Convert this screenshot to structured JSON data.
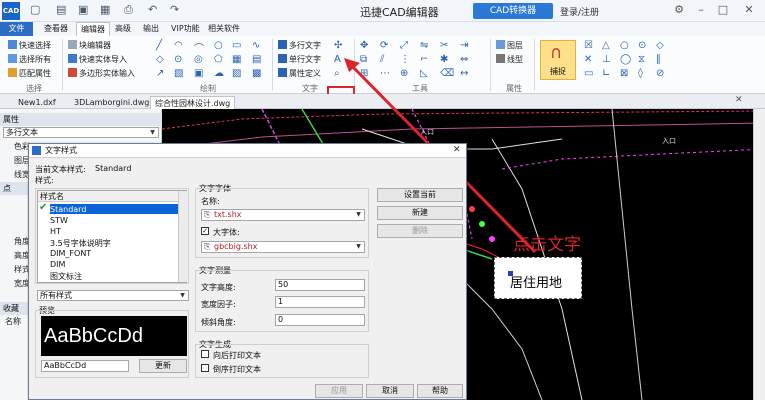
{
  "app": {
    "logo": "CAD",
    "title": "迅捷CAD编辑器",
    "convert_label": "CAD转换器",
    "login": "登录/注册"
  },
  "menu": {
    "tabs": [
      "文件",
      "查看器",
      "编辑器",
      "高级",
      "输出",
      "VIP功能",
      "相关软件"
    ]
  },
  "ribbon": {
    "select_group": [
      "快速选择",
      "选择所有",
      "匹配属性"
    ],
    "edit_group": [
      "块编辑器",
      "快速实体导入",
      "多边形实体输入"
    ],
    "text_group": [
      "多行文字",
      "单行文字",
      "属性定义"
    ],
    "layer_items": [
      "图层",
      "线型"
    ],
    "snap_label": "捕捉",
    "groups": [
      "选择",
      "绘制",
      "文字",
      "工具",
      "属性"
    ]
  },
  "doc_tabs": [
    "New1.dxf",
    "3DLamborgini.dwg",
    "综合性园林设计.dwg"
  ],
  "props": {
    "title": "属性",
    "selector": "多行文本",
    "rows": [
      "色彩",
      "图层",
      "线宽"
    ],
    "section_point": "点",
    "rows2": [
      "角度",
      "高度",
      "样式",
      "宽度"
    ],
    "section_collect": "收藏",
    "section_name": "名称"
  },
  "dialog": {
    "title": "文字样式",
    "current_label": "当前文本样式:",
    "current_value": "Standard",
    "style_label": "样式:",
    "list_header": "样式名",
    "styles": [
      "Standard",
      "STW",
      "HT",
      "3.5号字体说明字",
      "DIM_FONT",
      "DIM",
      "图文标注"
    ],
    "filter_value": "所有样式",
    "preview_label": "预览",
    "preview_text": "AaBbCcDd",
    "preview_input": "AaBbCcDd",
    "update_button": "更新",
    "font_group": "文字字体",
    "name_label": "名称:",
    "font_name": "txt.shx",
    "bigfont_label": "大字体:",
    "bigfont_name": "gbcbig.shx",
    "measure_group": "文字测量",
    "height_label": "文字高度:",
    "height_value": "50",
    "width_label": "宽度因子:",
    "width_value": "1",
    "angle_label": "倾斜角度:",
    "angle_value": "0",
    "gen_group": "文字生成",
    "backward_label": "向后打印文本",
    "upside_label": "倒序打印文本",
    "set_current_button": "设置当前",
    "new_button": "新建",
    "delete_button": "删除",
    "apply_button": "应用",
    "cancel_button": "取消",
    "help_button": "帮助"
  },
  "annotation": {
    "click_text": "点击文字",
    "sample_text": "居住用地",
    "canvas_marks": [
      "入口",
      "入口"
    ]
  },
  "colors": {
    "accent": "#2b6cc4",
    "annotation_red": "#d8262a",
    "canvas_bg": "#000000"
  }
}
